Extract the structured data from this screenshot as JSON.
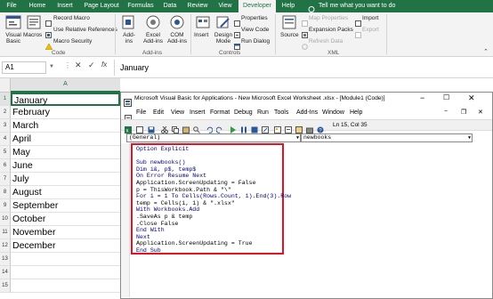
{
  "tabs": [
    "File",
    "Home",
    "Insert",
    "Page Layout",
    "Formulas",
    "Data",
    "Review",
    "View",
    "Developer",
    "Help"
  ],
  "tell_me": "Tell me what you want to do",
  "ribbon": {
    "visual_basic": [
      "Visual",
      "Basic"
    ],
    "macros": "Macros",
    "record_macro": "Record Macro",
    "use_relative": "Use Relative References",
    "macro_security": "Macro Security",
    "group_code": "Code",
    "addins": [
      "Add-",
      "ins"
    ],
    "excel_addins": [
      "Excel",
      "Add-ins"
    ],
    "com_addins": [
      "COM",
      "Add-ins"
    ],
    "group_addins": "Add-ins",
    "insert": "Insert",
    "design_mode": [
      "Design",
      "Mode"
    ],
    "properties": "Properties",
    "view_code": "View Code",
    "run_dialog": "Run Dialog",
    "group_controls": "Controls",
    "source": "Source",
    "map_properties": "Map Properties",
    "expansion_packs": "Expansion Packs",
    "refresh_data": "Refresh Data",
    "import": "Import",
    "export": "Export",
    "group_xml": "XML"
  },
  "formula_bar": {
    "name_box": "A1",
    "fx": "fx",
    "value": "January"
  },
  "sheet": {
    "column_a": "A",
    "rows": [
      "1",
      "2",
      "3",
      "4",
      "5",
      "6",
      "7",
      "8",
      "9",
      "10",
      "11",
      "12",
      "13",
      "14",
      "15"
    ],
    "cells": [
      "January",
      "February",
      "March",
      "April",
      "May",
      "June",
      "July",
      "August",
      "September",
      "October",
      "November",
      "December"
    ]
  },
  "vbe": {
    "title": "Microsoft Visual Basic for Applications - New Microsoft Excel Worksheet .xlsx - [Module1 (Code)]",
    "menus": [
      "File",
      "Edit",
      "View",
      "Insert",
      "Format",
      "Debug",
      "Run",
      "Tools",
      "Add-Ins",
      "Window",
      "Help"
    ],
    "position": "Ln 15, Col 35",
    "object_combo": "(General)",
    "proc_combo": "newbooks",
    "code": [
      "Option Explicit",
      "",
      "Sub newbooks()",
      "    Dim i&, p$, temp$",
      "On Error Resume Next",
      "Application.ScreenUpdating = False",
      "p = ThisWorkbook.Path & \"\\\"",
      "For i = 1 To Cells(Rows.Count, 1).End(3).Row",
      "temp = Cells(i, 1) & \".xlsx\"",
      "With Workbooks.Add",
      ".SaveAs p & temp",
      ".Close False",
      "End With",
      "Next",
      "Application.ScreenUpdating = True",
      "End Sub"
    ],
    "keyword_lines": [
      0,
      2,
      3,
      4,
      7,
      9,
      12,
      13,
      15
    ],
    "colors": {
      "keyword": "#00007f",
      "text": "#000000",
      "highlight": "#e81123"
    }
  }
}
